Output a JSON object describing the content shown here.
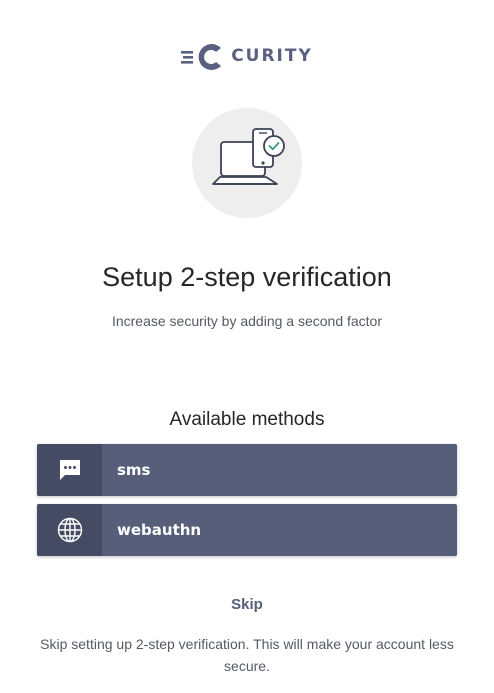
{
  "brand": {
    "name": "CURITY",
    "logo_color": "#5a6180"
  },
  "hero": {
    "icon": "laptop-phone-check-icon"
  },
  "header": {
    "title": "Setup 2-step verification",
    "subtitle": "Increase security by adding a second factor"
  },
  "methods": {
    "heading": "Available methods",
    "items": [
      {
        "label": "sms",
        "icon": "chat-bubble-icon"
      },
      {
        "label": "webauthn",
        "icon": "globe-icon"
      }
    ]
  },
  "skip": {
    "label": "Skip",
    "note": "Skip setting up 2-step verification. This will make your account less secure."
  },
  "colors": {
    "button_bg": "#565e7a",
    "icon_bg": "#454b62",
    "text_primary": "#26262b",
    "text_secondary": "#555a63"
  }
}
